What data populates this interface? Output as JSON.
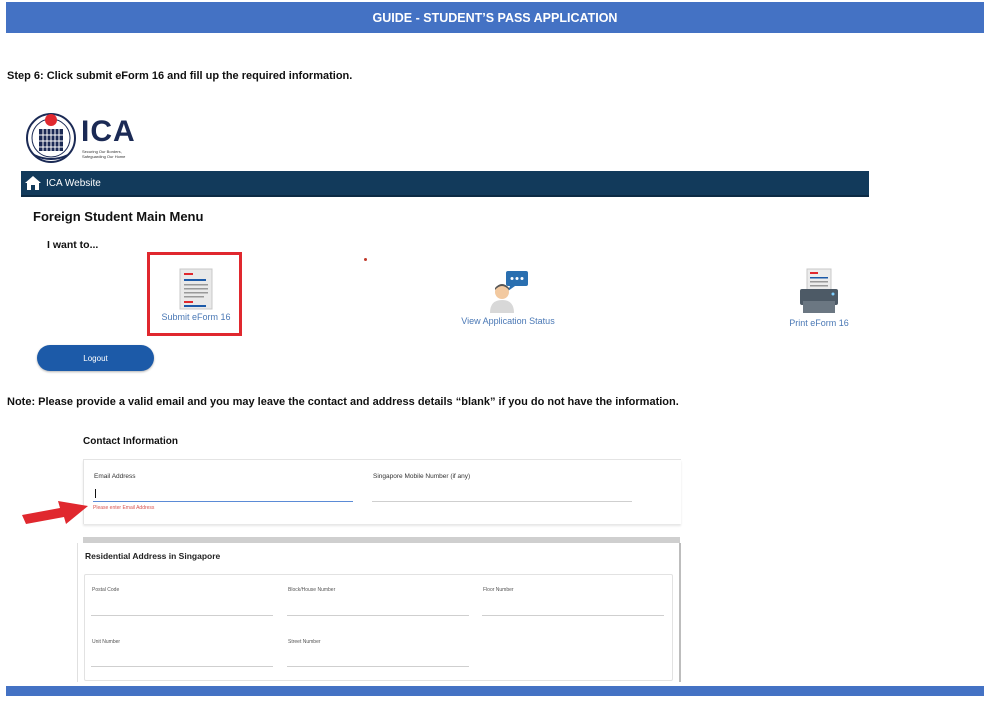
{
  "header": {
    "title": "GUIDE - STUDENT’S PASS APPLICATION"
  },
  "step_text": "Step 6: Click submit eForm 16 and fill up the required information.",
  "ica": {
    "logo_text": "ICA",
    "tagline": "Securing Our Borders, Safeguarding Our Home",
    "nav_label": "ICA Website",
    "menu_title": "Foreign Student Main Menu",
    "want_label": "I want to...",
    "tiles": [
      {
        "label": "Submit eForm 16"
      },
      {
        "label": "View Application Status"
      },
      {
        "label": "Print eForm 16"
      }
    ],
    "logout_label": "Logout"
  },
  "note_text": "Note: Please provide a valid email and you may leave the contact and address details “blank” if you do not have the information.",
  "contact": {
    "title": "Contact Information",
    "email_label": "Email Address",
    "email_error": "Please enter Email Address",
    "mobile_label": "Singapore Mobile Number (if any)"
  },
  "residential": {
    "title": "Residential Address in Singapore",
    "postal_label": "Postal Code",
    "block_label": "Block/House Number",
    "floor_label": "Floor Number",
    "unit_label": "Unit Number",
    "street_label": "Street Number"
  },
  "colors": {
    "banner": "#4472c4",
    "navbar": "#123a5b",
    "highlight": "#e0282e",
    "logout": "#1c5aa8",
    "link": "#4a78b5"
  }
}
